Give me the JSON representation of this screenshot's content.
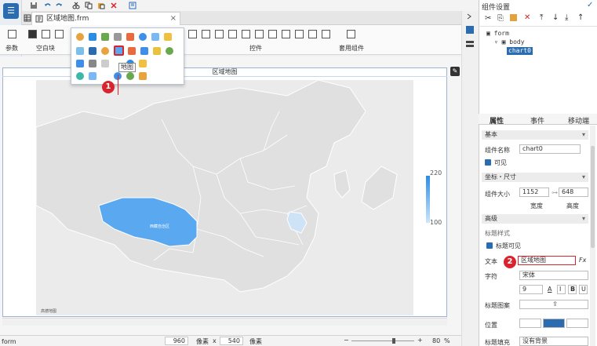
{
  "tab": {
    "filename": "区域地图.frm"
  },
  "ribbon": {
    "groups": [
      "参数",
      "空白块",
      "控件",
      "套用组件"
    ]
  },
  "popup": {
    "tooltip": "地图"
  },
  "badges": {
    "one": "1",
    "two": "2"
  },
  "canvas": {
    "title": "区域地图",
    "map_label": "西藏自治区",
    "legend_max": "220",
    "legend_min": "100",
    "attribution": "高德地图"
  },
  "statusbar": {
    "left": "form",
    "width": "960",
    "width_unit": "像素",
    "times": "x",
    "height": "540",
    "height_unit": "像素",
    "zoom": "80",
    "zoom_unit": "%"
  },
  "panel": {
    "title": "组件设置",
    "tree": {
      "root": "form",
      "body": "body",
      "chart": "chart0"
    },
    "tabs": [
      "属性",
      "事件",
      "移动端"
    ],
    "basic": "基本",
    "comp_name_label": "组件名称",
    "comp_name_value": "chart0",
    "visible_label": "可见",
    "coord_section": "坐标・尺寸",
    "size_label": "组件大小",
    "width_value": "1152",
    "height_value": "648",
    "width_caption": "宽度",
    "height_caption": "高度",
    "advanced": "高级",
    "title_style": "标题样式",
    "title_visible": "标题可见",
    "text_label": "文本",
    "text_value": "区域地图",
    "fx": "Fx",
    "font_label": "字符",
    "font_value": "宋体",
    "font_size": "9",
    "bold": "B",
    "italic": "I",
    "underline": "U",
    "title_img_label": "标题图案",
    "position_label": "位置",
    "fill_label": "标题填充",
    "fill_value": "没有背景"
  },
  "colors": {
    "accent": "#2b6cb0",
    "map_highlight": "#5aa9f0",
    "map_light": "#cfe3f6",
    "badge": "#d9232d"
  }
}
